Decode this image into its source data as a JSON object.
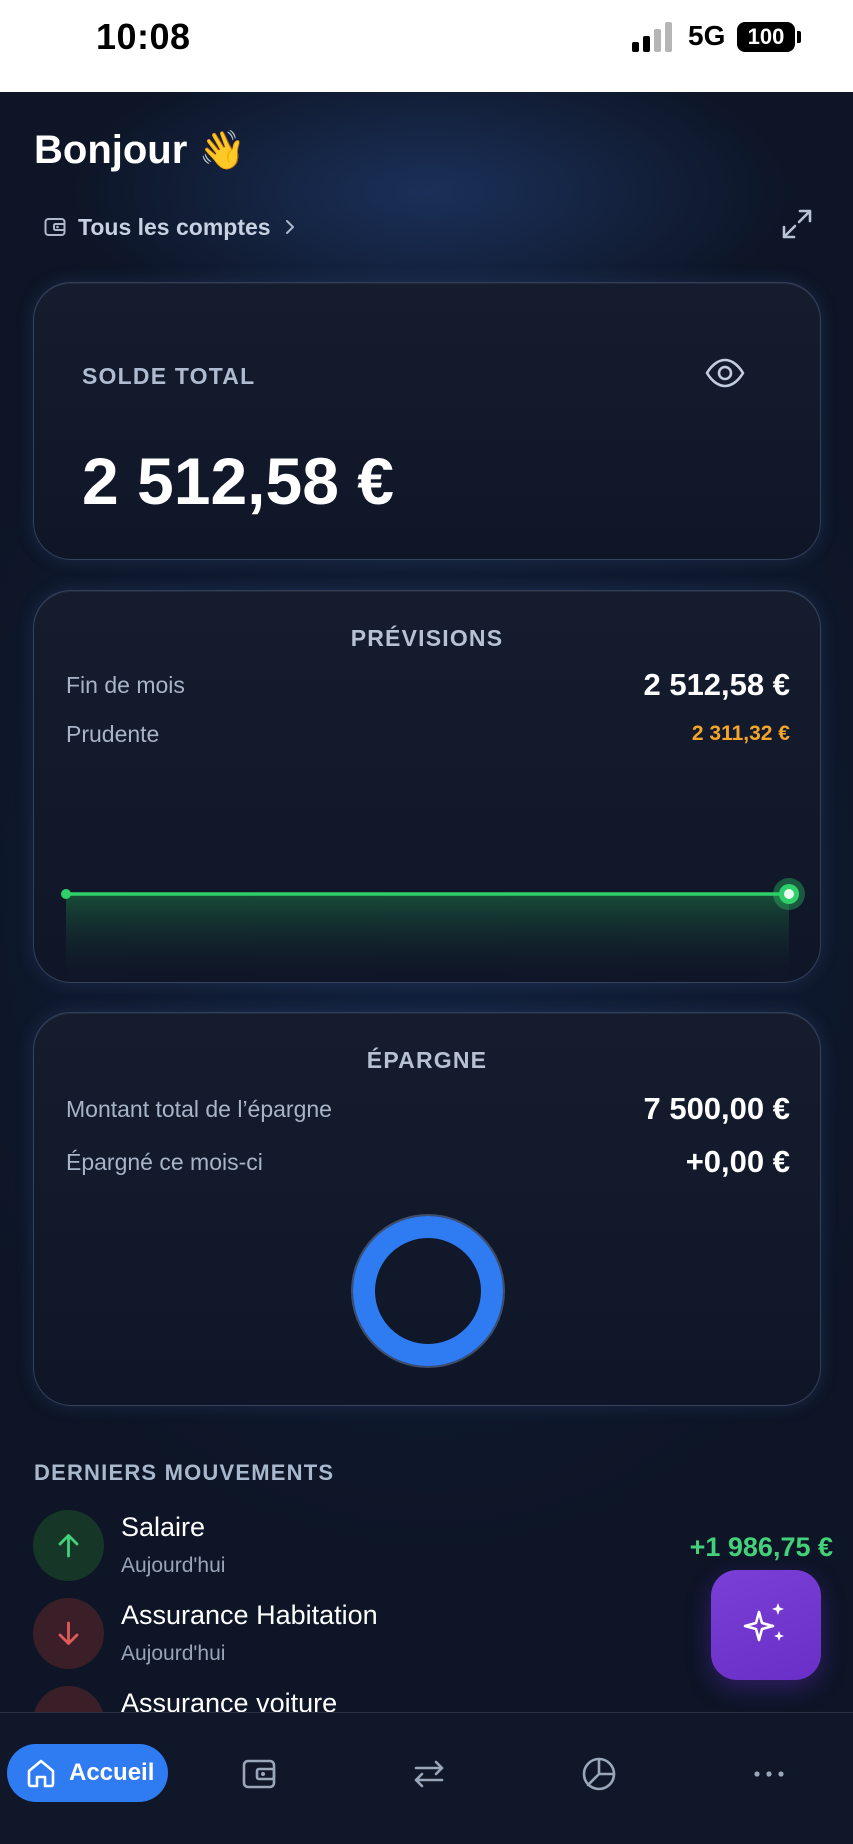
{
  "status_bar": {
    "time": "10:08",
    "network": "5G",
    "battery": "100"
  },
  "header": {
    "greeting": "Bonjour",
    "greeting_emoji": "👋",
    "account_selector": "Tous les comptes",
    "icons": {
      "wallet": "wallet-icon",
      "chevron": "chevron-right-icon",
      "expand": "expand-icon"
    }
  },
  "balance_card": {
    "label": "SOLDE TOTAL",
    "amount": "2 512,58 €",
    "visibility_icon": "eye-icon"
  },
  "forecast_card": {
    "title": "PRÉVISIONS",
    "rows": [
      {
        "label": "Fin de mois",
        "value": "2 512,58 €"
      },
      {
        "label": "Prudente",
        "value": "2 311,32 €"
      }
    ],
    "line_color": "#2fd06a",
    "prudent_color": "#f4a62a"
  },
  "savings_card": {
    "title": "ÉPARGNE",
    "rows": [
      {
        "label": "Montant total de l’épargne",
        "value": "7 500,00 €"
      },
      {
        "label": "Épargné ce mois-ci",
        "value": "+0,00 €"
      }
    ],
    "donut_color": "#2f7bf2"
  },
  "movements": {
    "title": "DERNIERS MOUVEMENTS",
    "items": [
      {
        "name": "Salaire",
        "date": "Aujourd'hui",
        "amount": "+1 986,75 €",
        "direction": "in"
      },
      {
        "name": "Assurance Habitation",
        "date": "Aujourd'hui",
        "amount": "",
        "direction": "out"
      },
      {
        "name": "Assurance voiture",
        "date": "",
        "amount": "",
        "direction": "out"
      }
    ]
  },
  "fab": {
    "icon": "sparkles-icon"
  },
  "bottom_nav": {
    "items": [
      {
        "label": "Accueil",
        "icon": "home-icon",
        "active": true
      },
      {
        "label": "",
        "icon": "wallet-icon"
      },
      {
        "label": "",
        "icon": "transfer-icon"
      },
      {
        "label": "",
        "icon": "pie-chart-icon"
      },
      {
        "label": "",
        "icon": "more-icon"
      }
    ]
  },
  "colors": {
    "background": "#0d1526",
    "accent_blue": "#2f7bf2",
    "positive": "#43d17a",
    "negative": "#e05a5a",
    "fab_purple": "#7a3fd6"
  }
}
